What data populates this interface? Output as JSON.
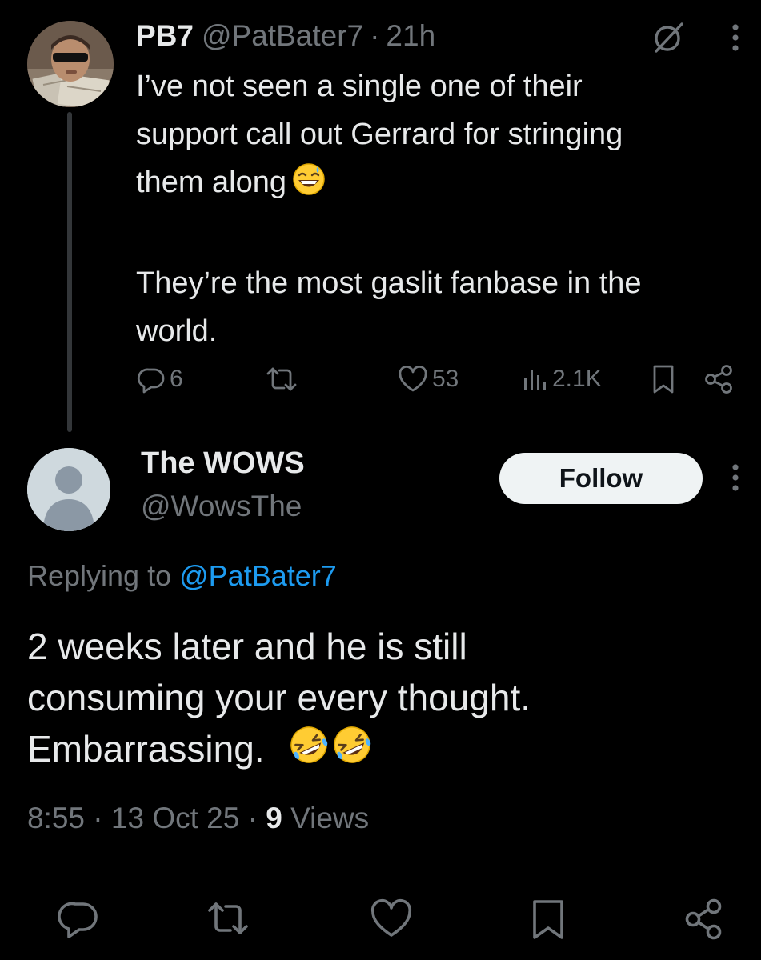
{
  "parent_tweet": {
    "display_name": "PB7",
    "handle": "@PatBater7",
    "separator": "·",
    "time_ago": "21h",
    "text_lines": [
      "I’ve not seen a single one of their",
      "support call out Gerrard for stringing",
      "them along"
    ],
    "text_emoji": "grinning-face-with-sweat-emoji",
    "text_paragraph2_lines": [
      "They’re the most gaslit fanbase in the",
      "world."
    ],
    "metrics": {
      "replies": "6",
      "reposts": "",
      "likes": "53",
      "views": "2.1K"
    }
  },
  "reply_tweet": {
    "display_name": "The WOWS",
    "handle": "@WowsThe",
    "follow_label": "Follow",
    "replying_prefix": "Replying to",
    "replying_to": "@PatBater7",
    "text_lines": [
      "2 weeks later and he is still",
      "consuming your every thought.",
      "Embarrassing."
    ],
    "text_emojis": [
      "rolling-on-the-floor-laughing-emoji",
      "rolling-on-the-floor-laughing-emoji"
    ],
    "time": "8:55",
    "separator": "·",
    "date": "13 Oct 25",
    "views_count": "9",
    "views_label": "Views"
  },
  "action_bar": [
    "reply-icon",
    "repost-icon",
    "like-icon",
    "bookmark-icon",
    "share-icon"
  ],
  "colors": {
    "background": "#000000",
    "text_primary": "#e7e9ea",
    "text_secondary": "#71767b",
    "link_blue": "#1d9bf0",
    "follow_button_bg": "#eff3f4",
    "divider": "#2f3336"
  }
}
